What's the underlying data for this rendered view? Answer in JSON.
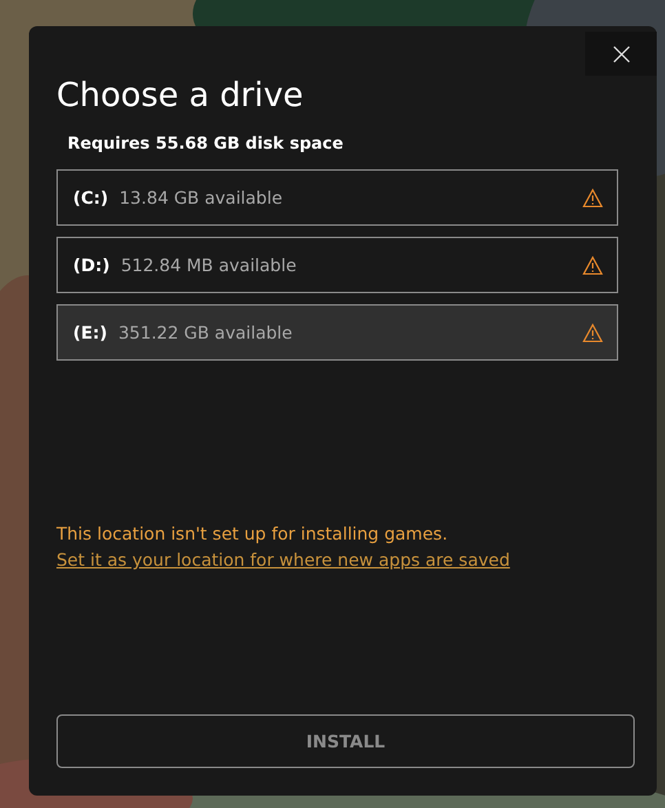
{
  "dialog": {
    "title": "Choose a drive",
    "requirement": "Requires 55.68 GB disk space",
    "drives": [
      {
        "letter": "(C:)",
        "space": "13.84 GB available",
        "warning": true,
        "selected": false
      },
      {
        "letter": "(D:)",
        "space": "512.84 MB available",
        "warning": true,
        "selected": false
      },
      {
        "letter": "(E:)",
        "space": "351.22 GB available",
        "warning": true,
        "selected": true
      }
    ],
    "warning_message": "This location isn't set up for installing games.",
    "warning_link": "Set it as your location for where new apps are saved",
    "install_button": {
      "label": "INSTALL",
      "disabled": true
    }
  }
}
